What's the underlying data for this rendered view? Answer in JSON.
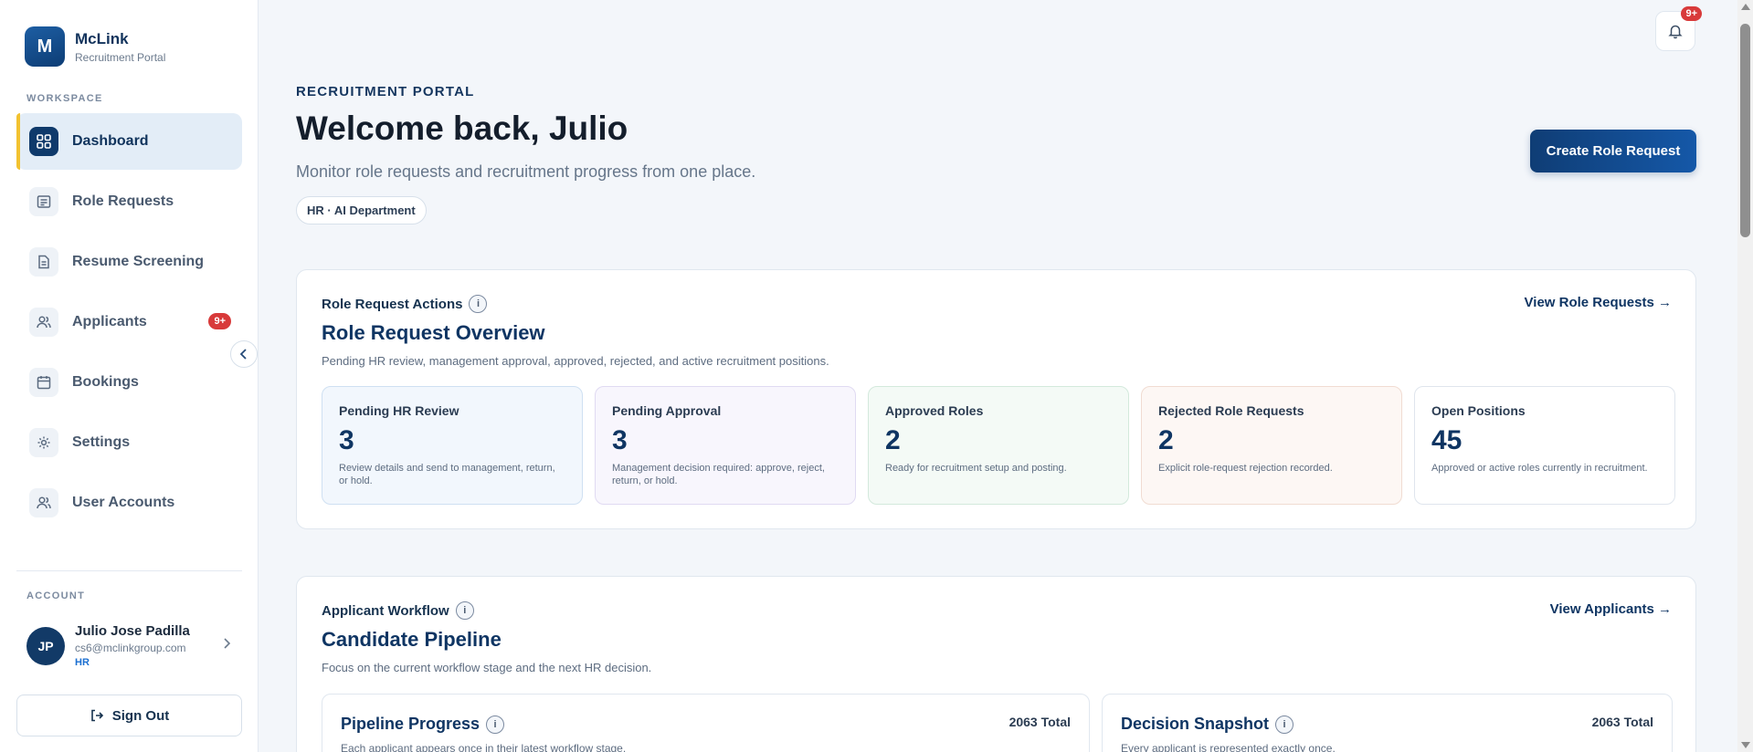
{
  "brand": {
    "logo_letter": "M",
    "name": "McLink",
    "subtitle": "Recruitment Portal"
  },
  "sidebar": {
    "workspace_label": "WORKSPACE",
    "items": [
      {
        "label": "Dashboard",
        "icon": "grid-icon",
        "active": true
      },
      {
        "label": "Role Requests",
        "icon": "list-icon"
      },
      {
        "label": "Resume Screening",
        "icon": "document-icon"
      },
      {
        "label": "Applicants",
        "icon": "users-icon",
        "badge": "9+"
      },
      {
        "label": "Bookings",
        "icon": "calendar-icon"
      },
      {
        "label": "Settings",
        "icon": "gear-icon"
      },
      {
        "label": "User Accounts",
        "icon": "users-icon"
      }
    ],
    "account_label": "ACCOUNT",
    "user": {
      "initials": "JP",
      "name": "Julio Jose Padilla",
      "email": "cs6@mclinkgroup.com",
      "role": "HR"
    },
    "sign_out": "Sign Out"
  },
  "header": {
    "notification_badge": "9+",
    "eyebrow": "RECRUITMENT PORTAL",
    "welcome": "Welcome back, Julio",
    "subtitle": "Monitor role requests and recruitment progress from one place.",
    "department": "HR · AI Department",
    "create_button": "Create Role Request"
  },
  "role_overview": {
    "kicker": "Role Request Actions",
    "title": "Role Request Overview",
    "description": "Pending HR review, management approval, approved, rejected, and active recruitment positions.",
    "link": "View Role Requests →",
    "stats": [
      {
        "label": "Pending HR Review",
        "value": "3",
        "desc": "Review details and send to management, return, or hold.",
        "bg": "#f2f7fd",
        "border": "#cfe0f2"
      },
      {
        "label": "Pending Approval",
        "value": "3",
        "desc": "Management decision required: approve, reject, return, or hold.",
        "bg": "#f8f6fd",
        "border": "#e0daf2"
      },
      {
        "label": "Approved Roles",
        "value": "2",
        "desc": "Ready for recruitment setup and posting.",
        "bg": "#f4faf6",
        "border": "#d3e9dc"
      },
      {
        "label": "Rejected Role Requests",
        "value": "2",
        "desc": "Explicit role-request rejection recorded.",
        "bg": "#fdf7f4",
        "border": "#f1dcd2"
      },
      {
        "label": "Open Positions",
        "value": "45",
        "desc": "Approved or active roles currently in recruitment.",
        "bg": "#ffffff",
        "border": "#dfe5ed"
      }
    ]
  },
  "pipeline": {
    "kicker": "Applicant Workflow",
    "title": "Candidate Pipeline",
    "description": "Focus on the current workflow stage and the next HR decision.",
    "link": "View Applicants →",
    "progress": {
      "title": "Pipeline Progress",
      "total": "2063 Total",
      "desc": "Each applicant appears once in their latest workflow stage."
    },
    "snapshot": {
      "title": "Decision Snapshot",
      "total": "2063 Total",
      "desc": "Every applicant is represented exactly once."
    }
  }
}
